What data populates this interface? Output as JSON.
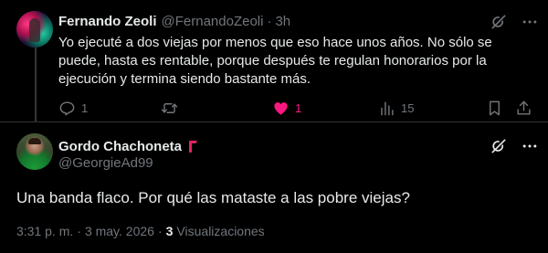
{
  "reply_tweet": {
    "author_name": "Fernando Zeoli",
    "handle": "@FernandoZeoli",
    "separator": "·",
    "time": "3h",
    "text": "Yo ejecuté a dos viejas por menos que eso hace unos años. No sólo se puede, hasta es rentable, porque después te regulan honorarios por la ejecución y termina siendo bastante más.",
    "actions": {
      "replies": "1",
      "retweets": "",
      "likes": "1",
      "views": "15"
    },
    "liked": true
  },
  "main_tweet": {
    "author_name": "Gordo Chachoneta",
    "handle": "@GeorgieAd99",
    "text": "Una banda flaco. Por qué las mataste a las pobre viejas?",
    "time": "3:31 p. m.",
    "separator_1": "·",
    "date": "3 may. 2026",
    "separator_2": "·",
    "views_count": "3",
    "views_label": "Visualizaciones"
  },
  "icons": {
    "grok": "grok-icon",
    "more": "more-icon",
    "reply": "reply-icon",
    "retweet": "retweet-icon",
    "like": "like-icon",
    "views": "views-icon",
    "bookmark": "bookmark-icon",
    "share": "share-icon",
    "badge": "flag-badge-icon"
  },
  "colors": {
    "background": "#000000",
    "text": "#e7e9ea",
    "muted": "#71767b",
    "like": "#f91880",
    "badge": "#e0245e",
    "divider": "#2f3336"
  }
}
